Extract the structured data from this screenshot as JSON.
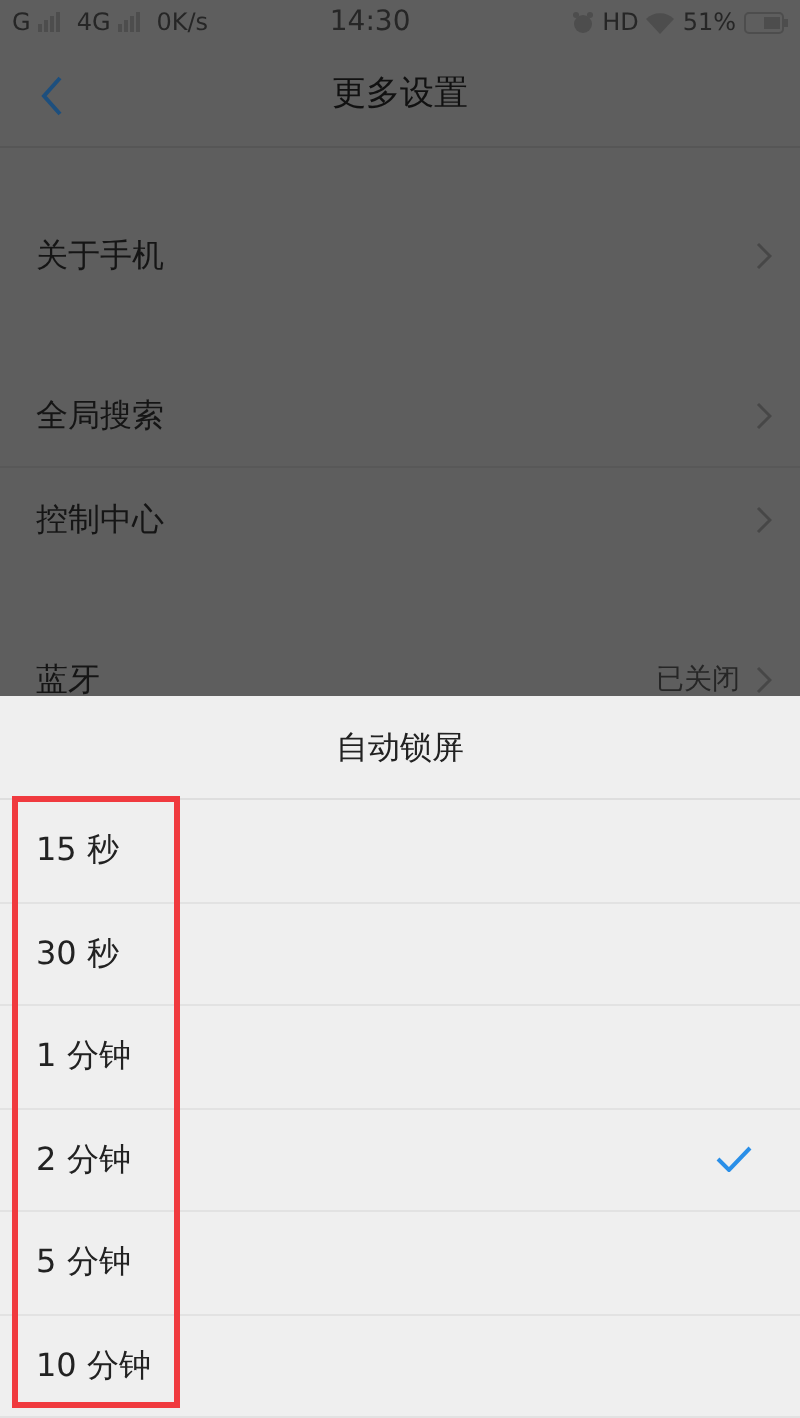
{
  "status_bar": {
    "signal_1": "G",
    "signal_2": "4G",
    "speed": "0K/s",
    "time": "14:30",
    "hd": "HD",
    "battery": "51%"
  },
  "header": {
    "title": "更多设置"
  },
  "groups": [
    {
      "items": [
        {
          "label": "关于手机"
        }
      ]
    },
    {
      "items": [
        {
          "label": "全局搜索"
        },
        {
          "label": "控制中心"
        }
      ]
    },
    {
      "items": [
        {
          "label": "蓝牙",
          "value": "已关闭"
        }
      ]
    }
  ],
  "sheet": {
    "title": "自动锁屏",
    "options": [
      {
        "label": "15 秒",
        "selected": false
      },
      {
        "label": "30 秒",
        "selected": false
      },
      {
        "label": "1 分钟",
        "selected": false
      },
      {
        "label": "2 分钟",
        "selected": true
      },
      {
        "label": "5 分钟",
        "selected": false
      },
      {
        "label": "10 分钟",
        "selected": false
      }
    ]
  }
}
